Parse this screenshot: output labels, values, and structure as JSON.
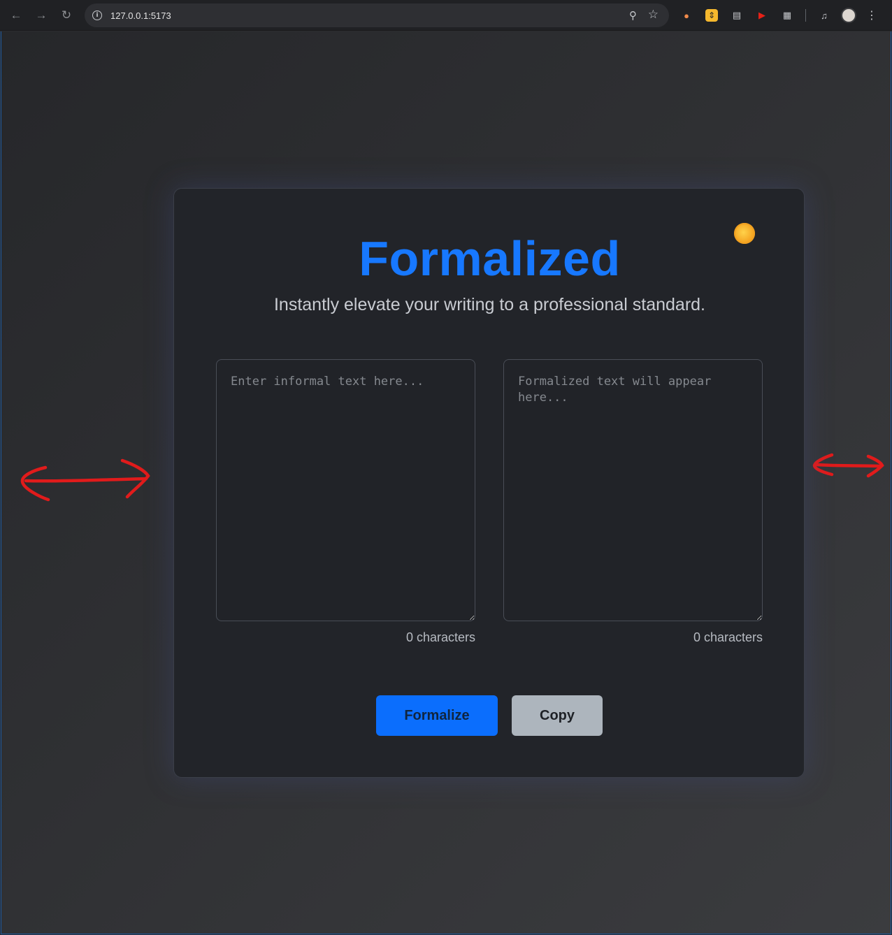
{
  "browser": {
    "url": "127.0.0.1:5173"
  },
  "app": {
    "title": "Formalized",
    "subtitle": "Instantly elevate your writing to a professional standard.",
    "input": {
      "placeholder": "Enter informal text here...",
      "char_count": "0 characters"
    },
    "output": {
      "placeholder": "Formalized text will appear here...",
      "char_count": "0 characters"
    },
    "buttons": {
      "formalize": "Formalize",
      "copy": "Copy"
    },
    "theme_icon": "sun-icon"
  },
  "colors": {
    "accent": "#0b6efd",
    "title": "#1778ff",
    "annotation": "#e11b1b"
  }
}
